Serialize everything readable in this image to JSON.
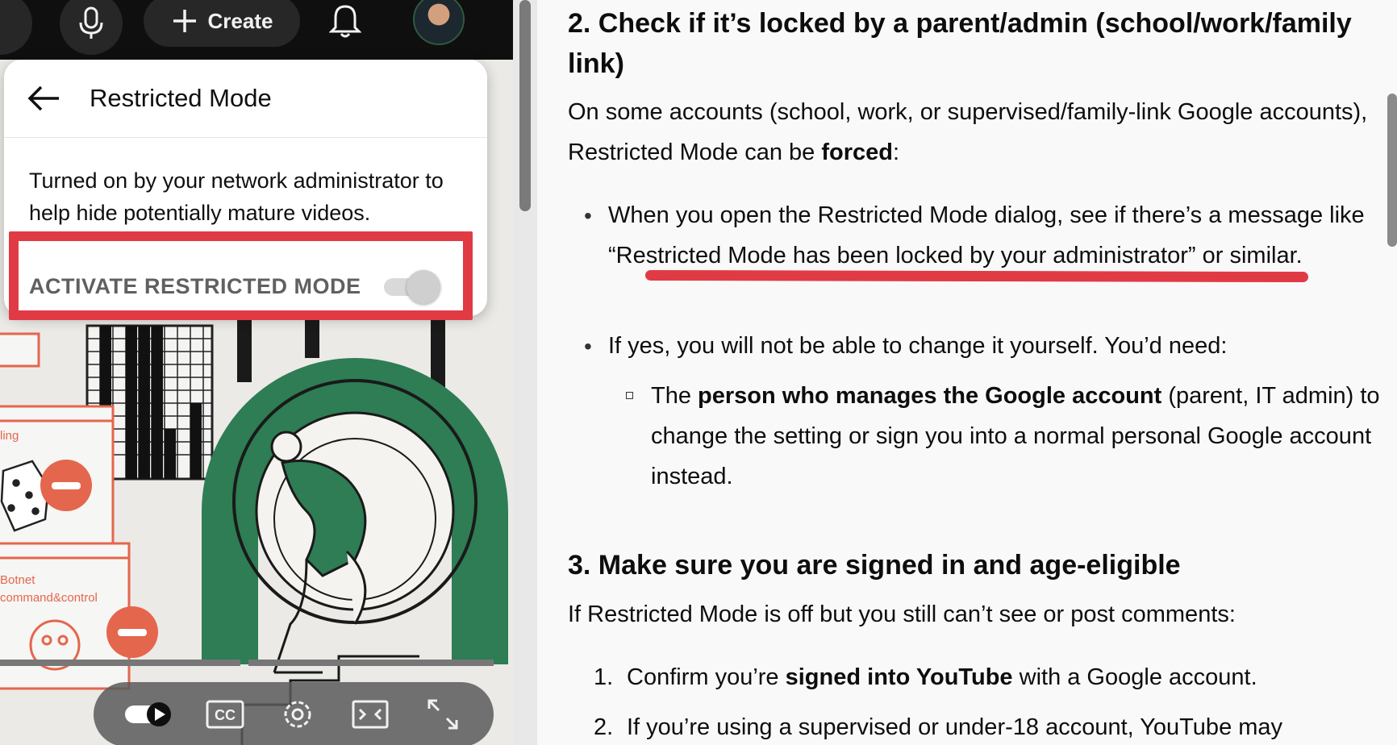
{
  "topbar": {
    "create_label": "Create",
    "icons": [
      "search-icon",
      "microphone-icon",
      "plus-icon",
      "bell-icon",
      "avatar"
    ]
  },
  "restricted_menu": {
    "title": "Restricted Mode",
    "description": "Turned on by your network administrator to help hide potentially mature videos.",
    "activate_label": "ACTIVATE RESTRICTED MODE",
    "toggle_state": "on (disabled)"
  },
  "illustration_text": {
    "label_ling": "ling",
    "label_botnet": "Botnet",
    "label_command": "command&control"
  },
  "player_controls": [
    "autoplay-toggle-icon",
    "captions-icon",
    "settings-icon",
    "miniplayer-icon",
    "fullscreen-icon"
  ],
  "article": {
    "section2_heading": "2. Check if it’s locked by a parent/admin (school/work/family link)",
    "section2_intro_a": "On some accounts (school, work, or supervised/family-link Google accounts), Restricted Mode can be ",
    "section2_intro_b": "forced",
    "section2_intro_c": ":",
    "bullet1_a": "When you open the Restricted Mode dialog, see if there’s a message like ",
    "bullet1_quote": "“Restricted Mode has been locked by your administrator”",
    "bullet1_b": " or similar.",
    "bullet2": "If yes, you will not be able to change it yourself. You’d need:",
    "sub_a": "The ",
    "sub_b": "person who manages the Google account",
    "sub_c": " (parent, IT admin) to change the setting or sign you into a normal personal Google account instead.",
    "section3_heading": "3. Make sure you are signed in and age-eligible",
    "section3_intro": "If Restricted Mode is off but you still can’t see or post comments:",
    "item1_num": "1.",
    "item1_a": "Confirm you’re ",
    "item1_b": "signed into YouTube",
    "item1_c": " with a Google account.",
    "item2_num": "2.",
    "item2": "If you’re using a supervised or under-18 account, YouTube may"
  },
  "colors": {
    "highlight_red": "#e03b44",
    "illustration_green": "#2e7d54",
    "illustration_orange": "#e4664d"
  }
}
